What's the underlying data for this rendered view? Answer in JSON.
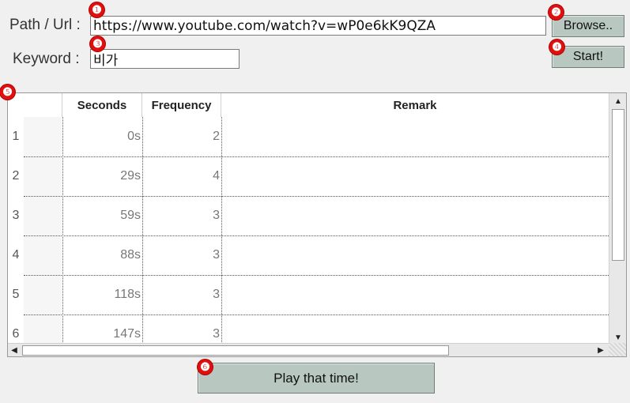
{
  "form": {
    "path_label": "Path / Url :",
    "path_value": "https://www.youtube.com/watch?v=wP0e6kK9QZA",
    "keyword_label": "Keyword :",
    "keyword_value": "비가",
    "browse_label": "Browse..",
    "start_label": "Start!",
    "play_label": "Play that time!"
  },
  "badges": [
    "❶",
    "❷",
    "❸",
    "❹",
    "❺",
    "❻"
  ],
  "table": {
    "columns": [
      "",
      "Seconds",
      "Frequency",
      "Remark"
    ],
    "rows": [
      {
        "index": "1",
        "seconds": "0s",
        "frequency": "2",
        "remark": ""
      },
      {
        "index": "2",
        "seconds": "29s",
        "frequency": "4",
        "remark": ""
      },
      {
        "index": "3",
        "seconds": "59s",
        "frequency": "3",
        "remark": ""
      },
      {
        "index": "4",
        "seconds": "88s",
        "frequency": "3",
        "remark": ""
      },
      {
        "index": "5",
        "seconds": "118s",
        "frequency": "3",
        "remark": ""
      },
      {
        "index": "6",
        "seconds": "147s",
        "frequency": "3",
        "remark": ""
      }
    ]
  },
  "scrollbars": {
    "up_icon": "▲",
    "down_icon": "▼",
    "left_icon": "◀",
    "right_icon": "▶"
  }
}
